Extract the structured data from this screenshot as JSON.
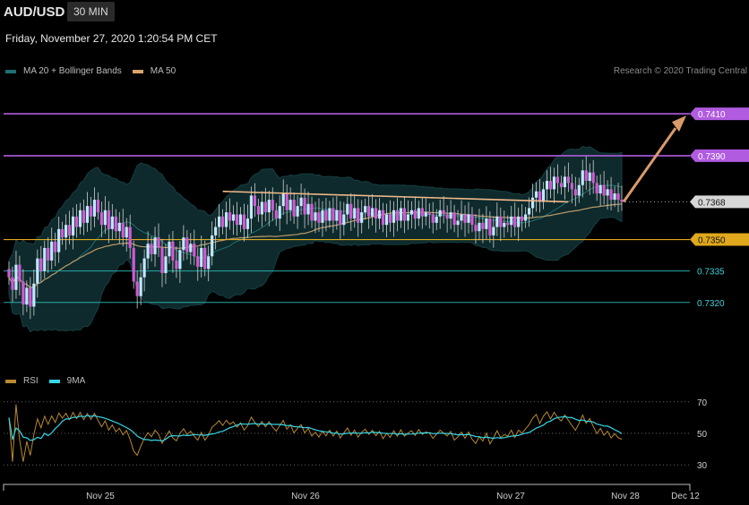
{
  "header": {
    "symbol": "AUD/USD",
    "timeframe": "30 MIN",
    "datetime": "Friday, November 27, 2020 1:20:54 PM CET"
  },
  "legend": {
    "main": [
      {
        "label": "MA 20 + Bollinger Bands",
        "color": "#1f6f73"
      },
      {
        "label": "MA 50",
        "color": "#d9a46b"
      }
    ],
    "rsi": [
      {
        "label": "RSI",
        "color": "#b8892f"
      },
      {
        "label": "9MA",
        "color": "#35d6e6"
      }
    ]
  },
  "credit": "Research © 2020 Trading Central",
  "chart_data": [
    {
      "type": "candlestick",
      "ylim": [
        0.729,
        0.7425
      ],
      "x_ticks": [
        "Nov 25",
        "Nov 26",
        "Nov 27",
        "Nov 28",
        "Dec 12"
      ],
      "levels": [
        {
          "value": 0.741,
          "label": "0.7410",
          "kind": "resistance",
          "color": "#b05be0"
        },
        {
          "value": 0.739,
          "label": "0.7390",
          "kind": "resistance",
          "color": "#b05be0"
        },
        {
          "value": 0.7368,
          "label": "0.7368",
          "kind": "last",
          "color": "#d7d7d7"
        },
        {
          "value": 0.735,
          "label": "0.7350",
          "kind": "pivot",
          "color": "#e0a81c"
        },
        {
          "value": 0.7335,
          "label": "0.7335",
          "kind": "support",
          "color": "#2aa8a8"
        },
        {
          "value": 0.732,
          "label": "0.7320",
          "kind": "support",
          "color": "#2aa8a8"
        }
      ],
      "closes": [
        0.7332,
        0.7326,
        0.7338,
        0.733,
        0.7319,
        0.7327,
        0.7318,
        0.7329,
        0.7341,
        0.7335,
        0.7346,
        0.734,
        0.7349,
        0.7344,
        0.7355,
        0.7351,
        0.7357,
        0.7352,
        0.7361,
        0.7356,
        0.7364,
        0.7358,
        0.7366,
        0.7361,
        0.7369,
        0.7363,
        0.7357,
        0.7364,
        0.7355,
        0.7361,
        0.7354,
        0.7358,
        0.7351,
        0.7356,
        0.7346,
        0.733,
        0.7323,
        0.7332,
        0.7341,
        0.7348,
        0.7343,
        0.7351,
        0.7346,
        0.7334,
        0.7342,
        0.7349,
        0.734,
        0.7336,
        0.7345,
        0.7351,
        0.7344,
        0.7348,
        0.7342,
        0.7337,
        0.7346,
        0.7336,
        0.7342,
        0.7352,
        0.7356,
        0.7361,
        0.7356,
        0.7363,
        0.7359,
        0.7362,
        0.7357,
        0.7362,
        0.7355,
        0.736,
        0.7371,
        0.7366,
        0.7362,
        0.7368,
        0.7363,
        0.7369,
        0.7364,
        0.736,
        0.7366,
        0.7372,
        0.7364,
        0.7369,
        0.7361,
        0.7366,
        0.737,
        0.7362,
        0.7367,
        0.7359,
        0.7363,
        0.7358,
        0.7364,
        0.7359,
        0.7365,
        0.7359,
        0.7364,
        0.7357,
        0.7362,
        0.7367,
        0.736,
        0.7365,
        0.7358,
        0.7363,
        0.7366,
        0.7361,
        0.7365,
        0.736,
        0.7364,
        0.7357,
        0.7362,
        0.7358,
        0.7364,
        0.7359,
        0.7365,
        0.7359,
        0.7362,
        0.7364,
        0.736,
        0.7365,
        0.7361,
        0.7363,
        0.7362,
        0.7358,
        0.7361,
        0.7364,
        0.7362,
        0.736,
        0.7363,
        0.7357,
        0.7359,
        0.7362,
        0.7358,
        0.7362,
        0.7357,
        0.7354,
        0.7358,
        0.7355,
        0.736,
        0.7352,
        0.7356,
        0.7361,
        0.7356,
        0.7358,
        0.7357,
        0.7361,
        0.7356,
        0.7361,
        0.7359,
        0.7362,
        0.7365,
        0.737,
        0.7373,
        0.7368,
        0.7374,
        0.7378,
        0.7374,
        0.738,
        0.7377,
        0.7375,
        0.738,
        0.7377,
        0.7374,
        0.7371,
        0.7376,
        0.7383,
        0.7378,
        0.7382,
        0.7377,
        0.7372,
        0.7376,
        0.7371,
        0.7374,
        0.7369,
        0.7372,
        0.7369,
        0.7368
      ],
      "forecast": [
        {
          "from": 0.7368,
          "to": 0.741
        }
      ],
      "trendline": {
        "from": 0.7373,
        "to": 0.7368
      }
    },
    {
      "type": "line",
      "title": "RSI",
      "ylim": [
        25,
        75
      ],
      "y_ticks": [
        70,
        50,
        30
      ],
      "series": [
        {
          "name": "RSI"
        },
        {
          "name": "9MA"
        }
      ]
    }
  ]
}
